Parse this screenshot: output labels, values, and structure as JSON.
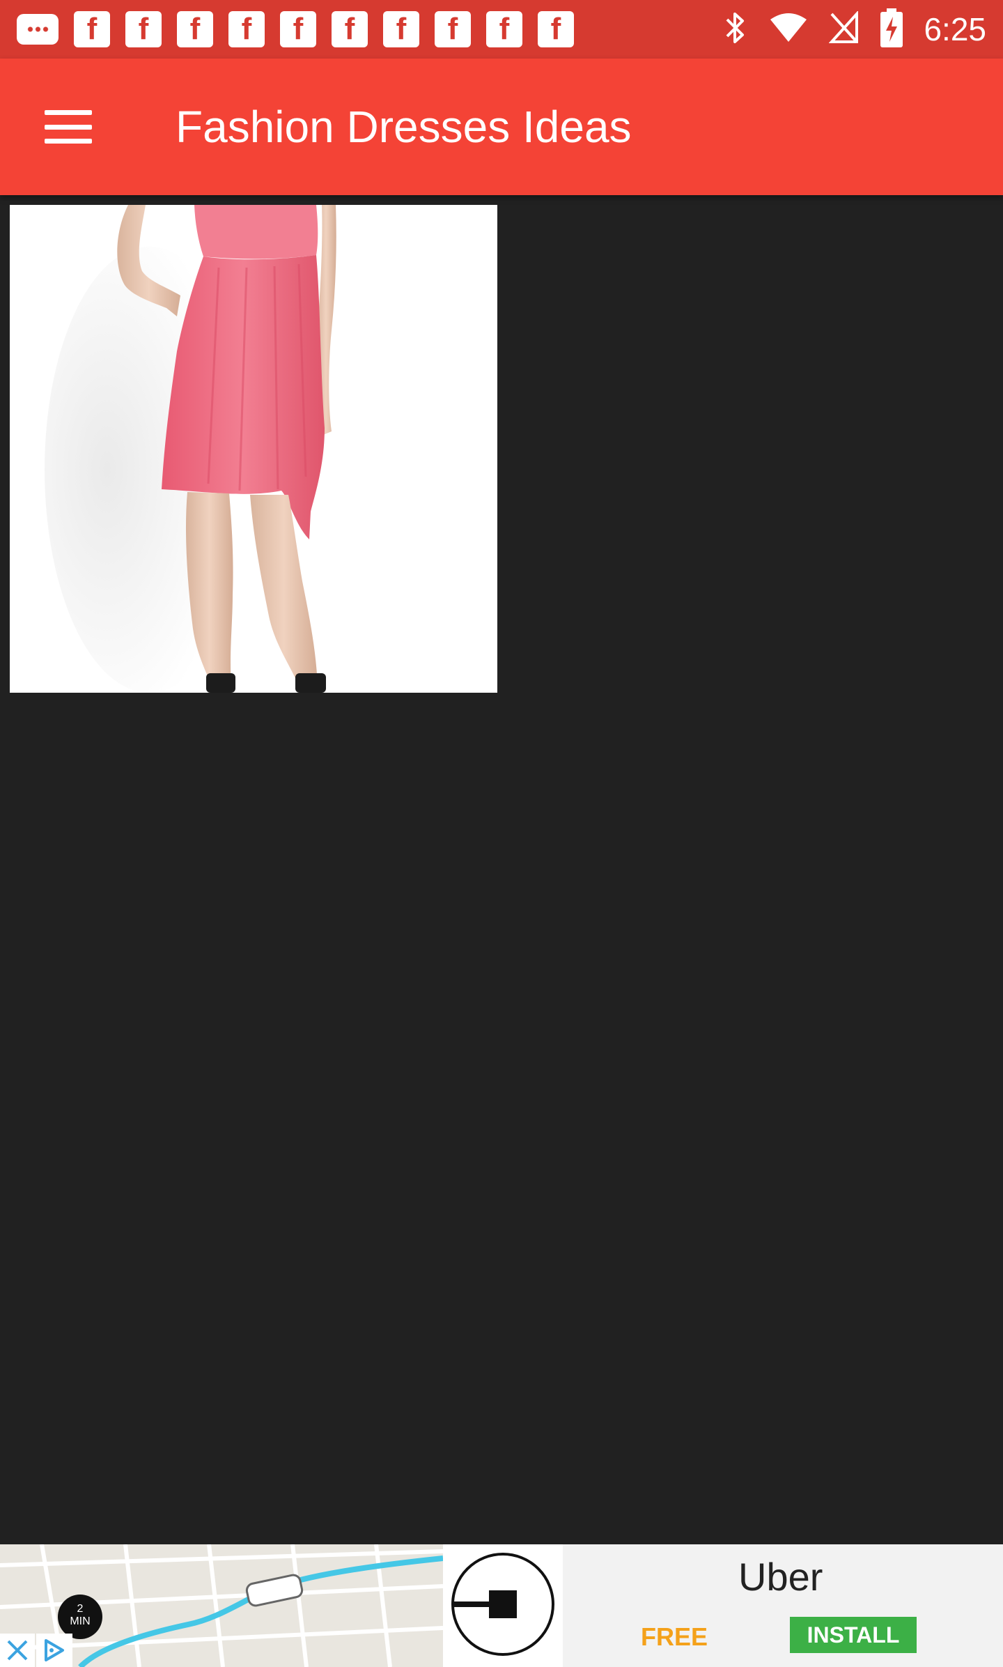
{
  "status_bar": {
    "time": "6:25",
    "notification_icons": [
      "chat-bubble-icon",
      "facebook-icon",
      "facebook-icon",
      "facebook-icon",
      "facebook-icon",
      "facebook-icon",
      "facebook-icon",
      "facebook-icon",
      "facebook-icon",
      "facebook-icon",
      "facebook-icon"
    ],
    "system_icons": [
      "bluetooth-icon",
      "wifi-icon",
      "no-sim-icon",
      "battery-charging-icon"
    ]
  },
  "app_bar": {
    "title": "Fashion Dresses Ideas",
    "menu_icon": "hamburger-menu-icon",
    "color": "#f44336"
  },
  "gallery": {
    "items": [
      {
        "image": "pink-dress-photo"
      }
    ]
  },
  "ad": {
    "brand": "Uber",
    "free_label": "FREE",
    "install_label": "INSTALL",
    "eta_number": "2",
    "eta_unit": "MIN",
    "close_icon": "close-icon",
    "adchoices_icon": "adchoices-icon"
  },
  "colors": {
    "status_bar": "#d63a30",
    "app_bar": "#f44336",
    "background": "#212121",
    "install_button": "#3cb046",
    "free_text": "#f4a11a"
  }
}
